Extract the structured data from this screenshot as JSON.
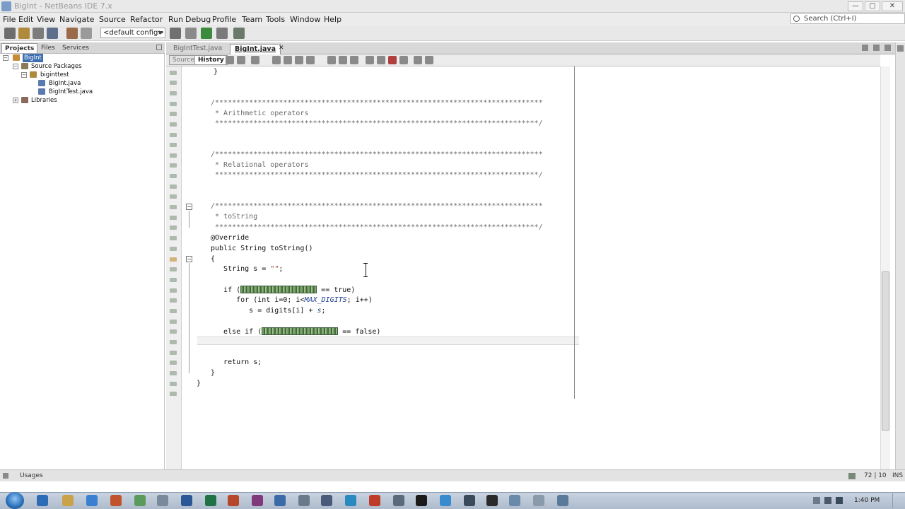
{
  "window": {
    "title": "BigInt - NetBeans IDE 7.x",
    "min": "—",
    "max": "▢",
    "close": "✕"
  },
  "menu": [
    "File",
    "Edit",
    "View",
    "Navigate",
    "Source",
    "Refactor",
    "Run",
    "Debug",
    "Profile",
    "Team",
    "Tools",
    "Window",
    "Help"
  ],
  "search": {
    "placeholder": "Search (Ctrl+I)"
  },
  "toolbar": {
    "config": "<default config>"
  },
  "projects": {
    "tabs": [
      "Projects",
      "Files",
      "Services"
    ],
    "tree": [
      {
        "label": "BigInt",
        "depth": 0,
        "toggle": "−",
        "kind": "project"
      },
      {
        "label": "Source Packages",
        "depth": 1,
        "toggle": "−",
        "kind": "folder"
      },
      {
        "label": "biginttest",
        "depth": 2,
        "toggle": "−",
        "kind": "package"
      },
      {
        "label": "BigInt.java",
        "depth": 3,
        "toggle": "",
        "kind": "java"
      },
      {
        "label": "BigIntTest.java",
        "depth": 3,
        "toggle": "",
        "kind": "java"
      },
      {
        "label": "Libraries",
        "depth": 1,
        "toggle": "+",
        "kind": "library"
      }
    ]
  },
  "editor": {
    "tabs": [
      "BigIntTest.java",
      "BigInt.java"
    ],
    "source_label": "Source",
    "history_label": "History",
    "code": {
      "l0": "    }",
      "c1": "/*****************************************************************************",
      "c1b": " * Arithmetic operators",
      "c1c": " ****************************************************************************/",
      "c2": "/*****************************************************************************",
      "c2b": " * Relational operators",
      "c2c": " ****************************************************************************/",
      "c3": "/*****************************************************************************",
      "c3b": " * toString",
      "c3c": " ****************************************************************************/",
      "ann": "@Override",
      "sig": "public String toString()",
      "brace": "{",
      "decl_a": "   String s = ",
      "decl_str": "\"\"",
      "decl_b": ";",
      "if_a": "   if (",
      "if_b": " == true)",
      "for_a": "      for (int i=0; i<",
      "for_const": "MAX_DIGITS",
      "for_b": "; i++)",
      "assign_a": "         s = digits[i] + ",
      "assign_var": "s",
      "assign_b": ";",
      "elif_a": "   else if (",
      "elif_b": " == false)",
      "ret": "   return s;",
      "close1": "}",
      "close2": "}"
    }
  },
  "status": {
    "usages": "Usages",
    "position": "72 | 10",
    "mode": "INS"
  },
  "taskbar": {
    "clock": "1:40 PM"
  }
}
